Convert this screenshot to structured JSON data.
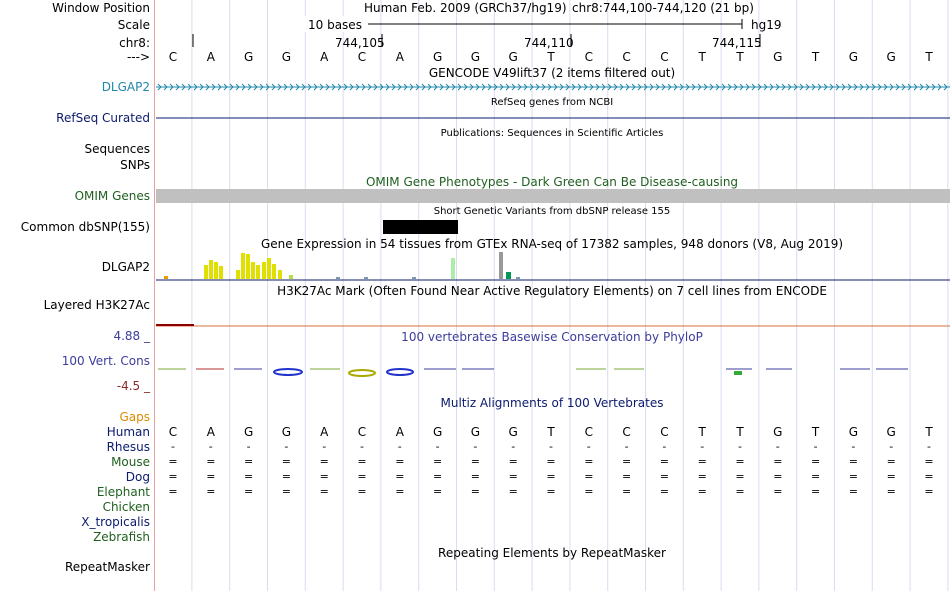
{
  "ruler": {
    "window_position_label": "Window Position",
    "scale_label": "Scale",
    "chrom_label": "chr8:",
    "arrow_label": "--->",
    "assembly_text": "Human Feb. 2009 (GRCh37/hg19)",
    "position_text": "chr8:744,100-744,120 (21 bp)",
    "scale_text": "10 bases",
    "db_text": "hg19",
    "ticks": [
      "744,105",
      "744,110",
      "744,115"
    ]
  },
  "sequence": [
    "C",
    "A",
    "G",
    "G",
    "A",
    "C",
    "A",
    "G",
    "G",
    "G",
    "T",
    "C",
    "C",
    "C",
    "T",
    "T",
    "G",
    "T",
    "G",
    "G",
    "T"
  ],
  "tracks": {
    "gencode": {
      "title": "GENCODE V49lift37 (2 items filtered out)",
      "label": "DLGAP2",
      "color": "#2288aa"
    },
    "refseq": {
      "title": "RefSeq genes from NCBI",
      "label": "RefSeq Curated",
      "color": "#0b1a6e"
    },
    "publications": {
      "title": "Publications: Sequences in Scientific Articles",
      "label1": "Sequences",
      "label2": "SNPs"
    },
    "omim": {
      "title": "OMIM Gene Phenotypes - Dark Green Can Be Disease-causing",
      "label": "OMIM Genes",
      "color": "#1f5f1f"
    },
    "dbsnp": {
      "title": "Short Genetic Variants from dbSNP release 155",
      "label": "Common dbSNP(155)"
    },
    "gtex": {
      "title": "Gene Expression in 54 tissues from GTEx RNA-seq of 17382 samples, 948 donors (V8, Aug 2019)",
      "label": "DLGAP2"
    },
    "h3k27ac": {
      "title": "H3K27Ac Mark (Often Found Near Active Regulatory Elements) on 7 cell lines from ENCODE",
      "label": "Layered H3K27Ac"
    },
    "phylop": {
      "title": "100 vertebrates Basewise Conservation by PhyloP",
      "label": "100 Vert. Cons",
      "max": "4.88 _",
      "min": "-4.5 _",
      "color": "#3c3c9c"
    },
    "multiz": {
      "title": "Multiz Alignments of 100 Vertebrates",
      "gaps_label": "Gaps",
      "species": [
        {
          "name": "Human",
          "color": "#0b1a6e"
        },
        {
          "name": "Rhesus",
          "color": "#0b1a6e"
        },
        {
          "name": "Mouse",
          "color": "#1f5f1f"
        },
        {
          "name": "Dog",
          "color": "#0b1a6e"
        },
        {
          "name": "Elephant",
          "color": "#1f5f1f"
        },
        {
          "name": "Chicken",
          "color": "#1f5f1f"
        },
        {
          "name": "X_tropicalis",
          "color": "#0b1a6e"
        },
        {
          "name": "Zebrafish",
          "color": "#1f5f1f"
        }
      ],
      "rhesus_row": "-",
      "eq_row": "="
    },
    "repeatmasker": {
      "title": "Repeating Elements by RepeatMasker",
      "label": "RepeatMasker"
    }
  },
  "colors": {
    "gaps": "#e08a00",
    "phylop_max": "#3c3c9c",
    "phylop_min": "#8a2a2a",
    "h3k27ac_line": "#8b0000"
  }
}
